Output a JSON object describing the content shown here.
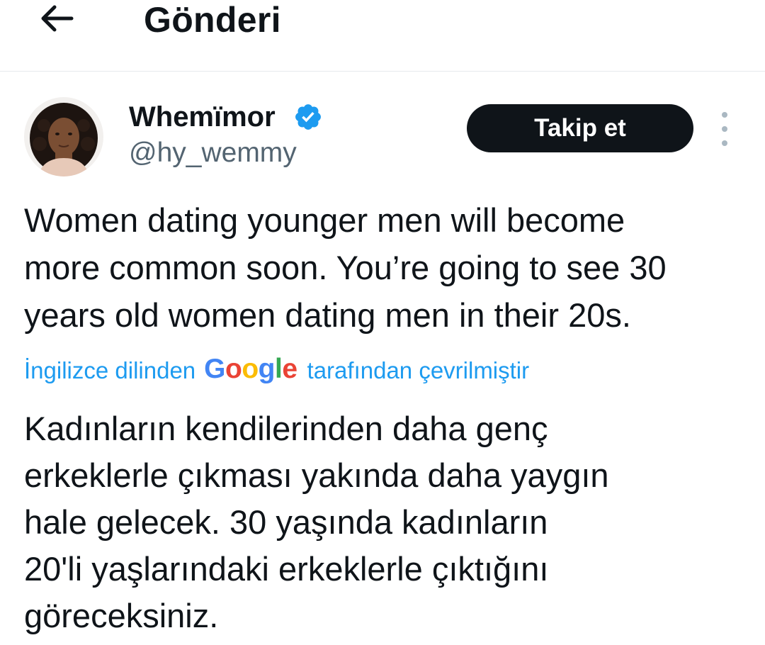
{
  "header": {
    "back_icon": "arrow-left-icon",
    "title": "Gönderi"
  },
  "author": {
    "display_name": "Whemïmor",
    "verified_icon": "verified-badge-icon",
    "verified_color": "#1d9bf0",
    "handle": "@hy_wemmy",
    "follow_label": "Takip et",
    "more_icon": "more-vertical-icon"
  },
  "tweet": {
    "text_lines": [
      "Women dating younger men will become",
      "more common soon. You’re going to see 30",
      "years old women dating men in their 20s."
    ]
  },
  "translation": {
    "prefix": "İngilizce dilinden",
    "provider_letters": [
      "G",
      "o",
      "o",
      "g",
      "l",
      "e"
    ],
    "suffix": "tarafından çevrilmiştir",
    "link_color": "#1d9bf0",
    "translated_lines": [
      "Kadınların kendilerinden daha genç",
      "erkeklerle çıkması yakında daha yaygın",
      "hale gelecek. 30 yaşında kadınların",
      "20'li yaşlarındaki erkeklerle çıktığını",
      "göreceksiniz."
    ]
  }
}
